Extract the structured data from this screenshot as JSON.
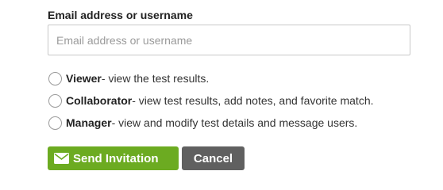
{
  "form": {
    "label": "Email address or username",
    "placeholder": "Email address or username",
    "value": ""
  },
  "roles": [
    {
      "name": "Viewer",
      "description": " - view the test results."
    },
    {
      "name": "Collaborator",
      "description": " - view test results, add notes, and favorite match."
    },
    {
      "name": "Manager",
      "description": " - view and modify test details and message users."
    }
  ],
  "buttons": {
    "send_label": "Send Invitation",
    "send_icon": "envelope-icon",
    "send_color": "#6cab21",
    "cancel_label": "Cancel",
    "cancel_color": "#606060"
  }
}
